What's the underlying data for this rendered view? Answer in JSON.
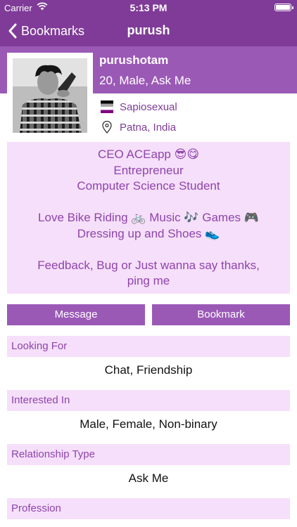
{
  "status_bar": {
    "carrier": "Carrier",
    "time": "5:13 PM"
  },
  "nav": {
    "back_label": "Bookmarks",
    "title": "purush"
  },
  "profile": {
    "name": "purushotam",
    "meta": "20, Male, Ask Me",
    "orientation": "Sapiosexual",
    "location": "Patna, India"
  },
  "bio": {
    "lines": [
      "CEO ACEapp 😎😋",
      "Entrepreneur",
      "Computer Science Student",
      "",
      "Love Bike Riding 🚲  Music 🎶 Games 🎮",
      "Dressing up and Shoes 👟",
      "",
      "Feedback, Bug or Just wanna say thanks,",
      "ping me"
    ]
  },
  "actions": {
    "message_label": "Message",
    "bookmark_label": "Bookmark"
  },
  "sections": [
    {
      "label": "Looking For",
      "value": "Chat, Friendship"
    },
    {
      "label": "Interested In",
      "value": "Male, Female, Non-binary"
    },
    {
      "label": "Relationship Type",
      "value": "Ask Me"
    },
    {
      "label": "Profession",
      "value": ""
    }
  ],
  "colors": {
    "nav_bar": "#7f3b97",
    "header_band": "#9b59b6",
    "accent_text": "#8e44ad",
    "section_background": "#f6dffa",
    "flag_stripes": [
      "#000000",
      "#a3a3a3",
      "#ffffff",
      "#800080"
    ]
  },
  "icons": {
    "back": "chevron-left-icon",
    "wifi": "wifi-icon",
    "battery": "battery-icon",
    "orientation": "asexual-flag-icon",
    "location": "location-pin-icon"
  }
}
